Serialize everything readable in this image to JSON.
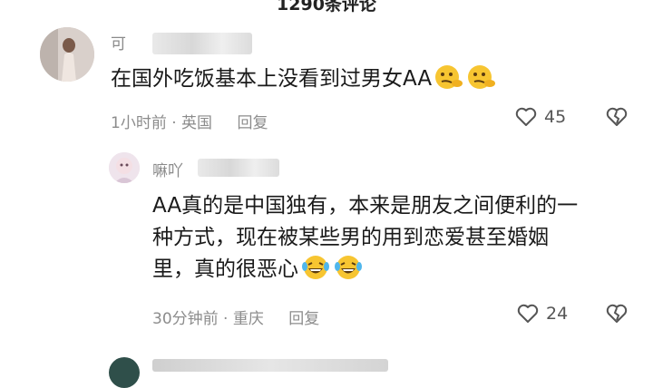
{
  "header": {
    "title": "1290条评论"
  },
  "comments": [
    {
      "name": "可",
      "text": "在国外吃饭基本上没看到过男女AA",
      "emoji": [
        "thinking-face",
        "thinking-face"
      ],
      "time": "1小时前",
      "location": "英国",
      "reply_label": "回复",
      "likes": "45"
    },
    {
      "name": "嘛吖",
      "text_lines": [
        "AA真的是中国独有，本来是朋友之间便利的一",
        "种方式，现在被某些男的用到恋爱甚至婚姻",
        "里，真的很恶心"
      ],
      "emoji": [
        "laughing-tears-face",
        "laughing-tears-face"
      ],
      "time": "30分钟前",
      "location": "重庆",
      "reply_label": "回复",
      "likes": "24"
    }
  ],
  "colors": {
    "meta": "#8c8c8c",
    "emoji_yellow": "#f7c531"
  }
}
